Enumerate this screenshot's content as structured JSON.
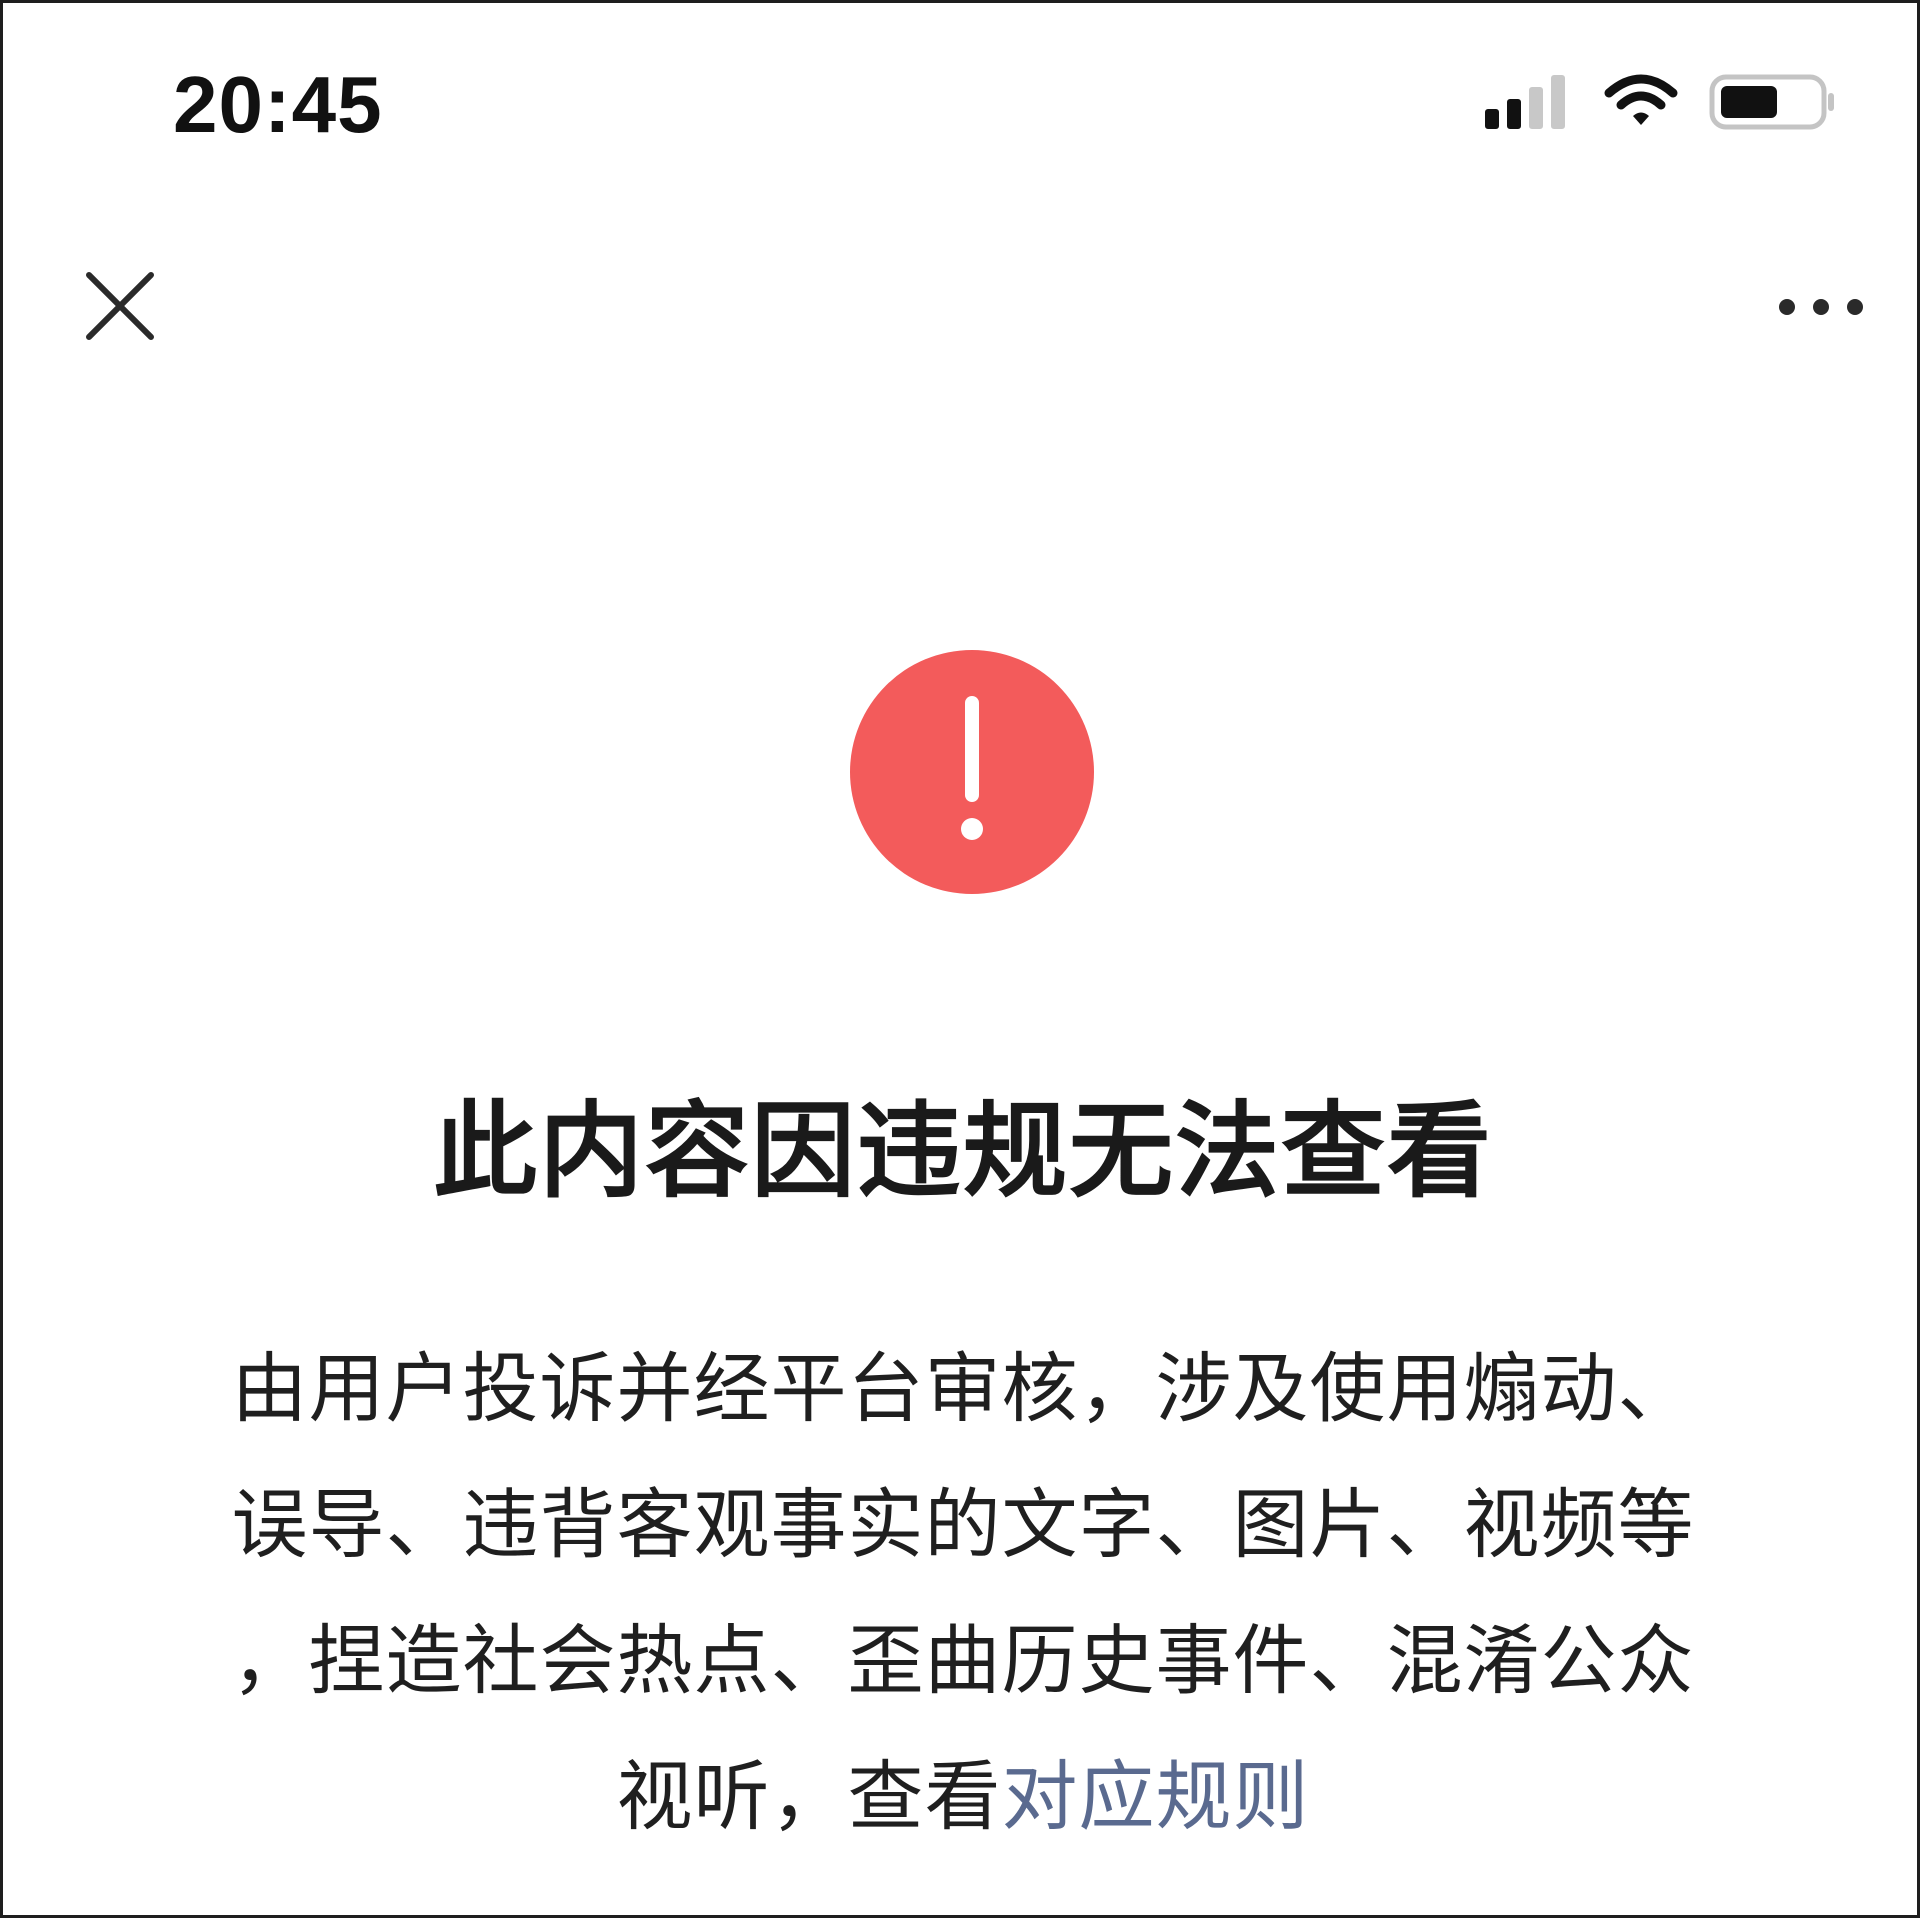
{
  "status_bar": {
    "time": "20:45"
  },
  "icons": {
    "signal": "cellular-signal-icon",
    "wifi": "wifi-icon",
    "battery": "battery-icon",
    "close": "close-icon",
    "more": "more-dots-icon",
    "warning": "exclamation-circle-icon"
  },
  "colors": {
    "warning": "#f35b5b",
    "link": "#5a6a8f"
  },
  "message": {
    "title": "此内容因违规无法查看",
    "body_lines": [
      "由用户投诉并经平台审核，涉及使用煽动、",
      "误导、违背客观事实的文字、图片、视频等",
      "，捏造社会热点、歪曲历史事件、混淆公众"
    ],
    "last_line_prefix": "视听，查看",
    "rules_link": "对应规则"
  }
}
